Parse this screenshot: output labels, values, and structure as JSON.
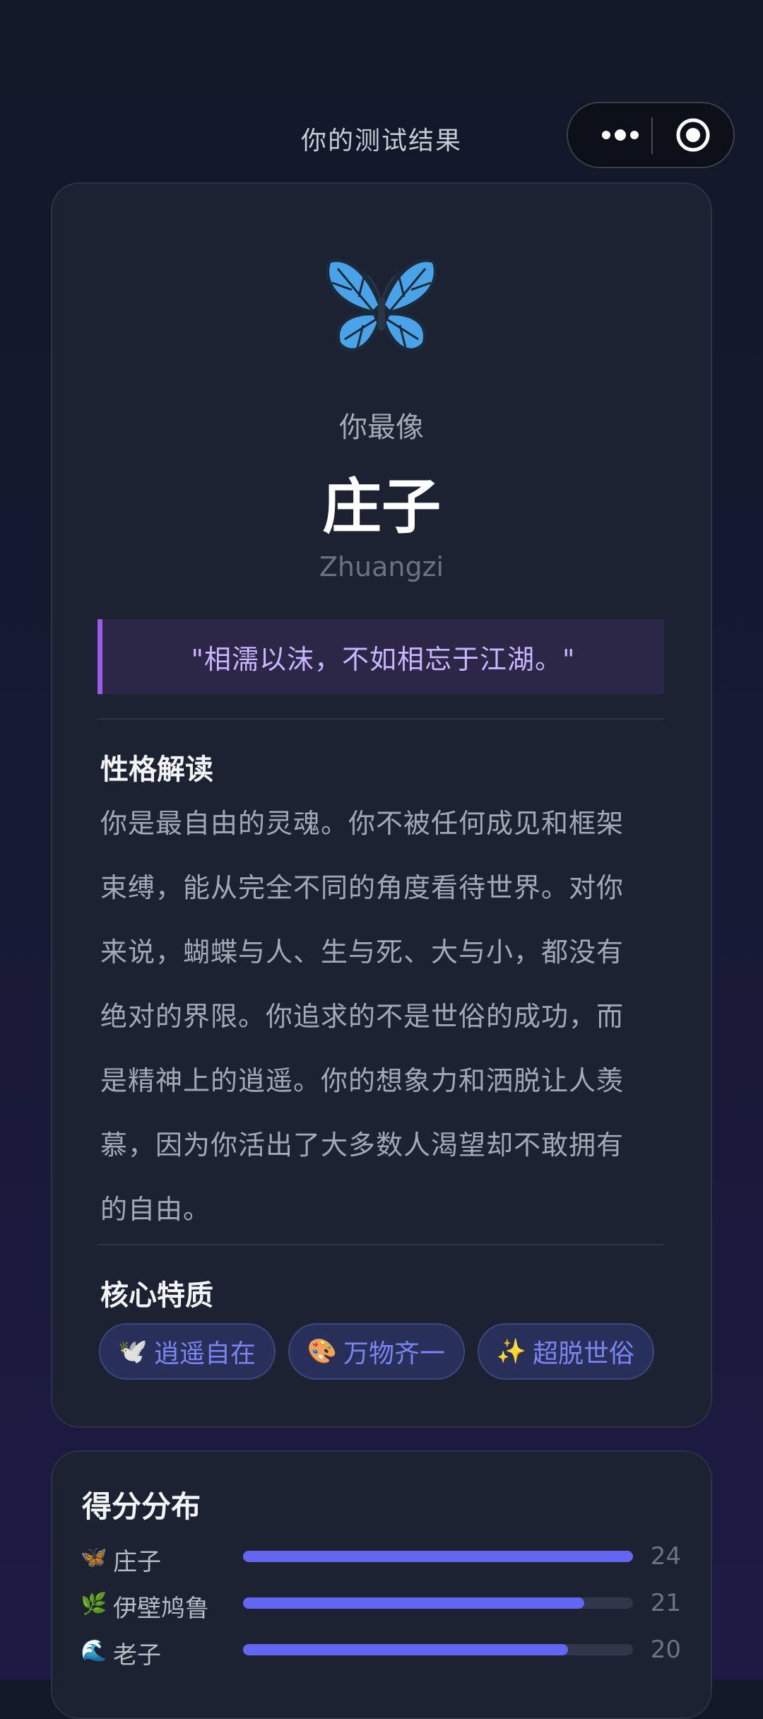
{
  "header": {
    "title": "你的测试结果"
  },
  "result": {
    "lead": "你最像",
    "name": "庄子",
    "name_en": "Zhuangzi",
    "icon": "butterfly-icon",
    "quote": "\"相濡以沫，不如相忘于江湖。\""
  },
  "personality": {
    "title": "性格解读",
    "lines": [
      "你是最自由的灵魂。你不被任何成见和框架",
      "束缚，能从完全不同的角度看待世界。对你",
      "来说，蝴蝶与人、生与死、大与小，都没有",
      "绝对的界限。你追求的不是世俗的成功，而",
      "是精神上的逍遥。你的想象力和洒脱让人羡",
      "慕，因为你活出了大多数人渴望却不敢拥有",
      "的自由。"
    ]
  },
  "traits": {
    "title": "核心特质",
    "items": [
      {
        "emoji": "🕊️",
        "label": "逍遥自在"
      },
      {
        "emoji": "🎨",
        "label": "万物齐一"
      },
      {
        "emoji": "✨",
        "label": "超脱世俗"
      }
    ]
  },
  "scores": {
    "title": "得分分布",
    "max": 24,
    "rows": [
      {
        "icon": "🦋",
        "name": "庄子",
        "value": 24
      },
      {
        "icon": "🌿",
        "name": "伊壁鸠鲁",
        "value": 21
      },
      {
        "icon": "🌊",
        "name": "老子",
        "value": 20
      }
    ]
  },
  "colors": {
    "accent": "#6366f1",
    "quote_accent": "#9b5de5",
    "card": "#1c2232"
  }
}
